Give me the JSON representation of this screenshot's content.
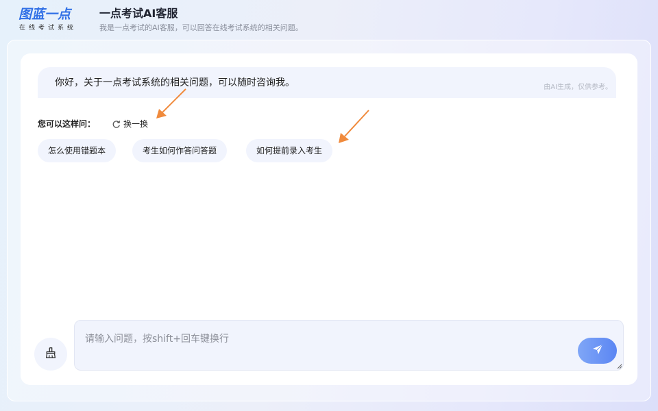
{
  "header": {
    "logo_main": "图蓝一点",
    "logo_sub": "在线考试系统",
    "title": "一点考试AI客服",
    "subtitle": "我是一点考试的AI客服，可以回答在线考试系统的相关问题。"
  },
  "chat": {
    "greeting": "你好，关于一点考试系统的相关问题，可以随时咨询我。",
    "ai_note": "由AI生成，仅供参考。"
  },
  "suggestions": {
    "label": "您可以这样问：",
    "refresh_label": "换一换",
    "items": [
      "怎么使用错题本",
      "考生如何作答问答题",
      "如何提前录入考生"
    ]
  },
  "input": {
    "placeholder": "请输入问题，按shift+回车键换行",
    "value": ""
  },
  "colors": {
    "brand": "#2f6fe6",
    "send_button": "#5b86f3",
    "chip_background": "#f1f4fd",
    "annotation_arrow": "#f08a3c"
  },
  "icons": {
    "refresh": "refresh-icon",
    "clear": "broom-icon",
    "send": "send-icon"
  }
}
